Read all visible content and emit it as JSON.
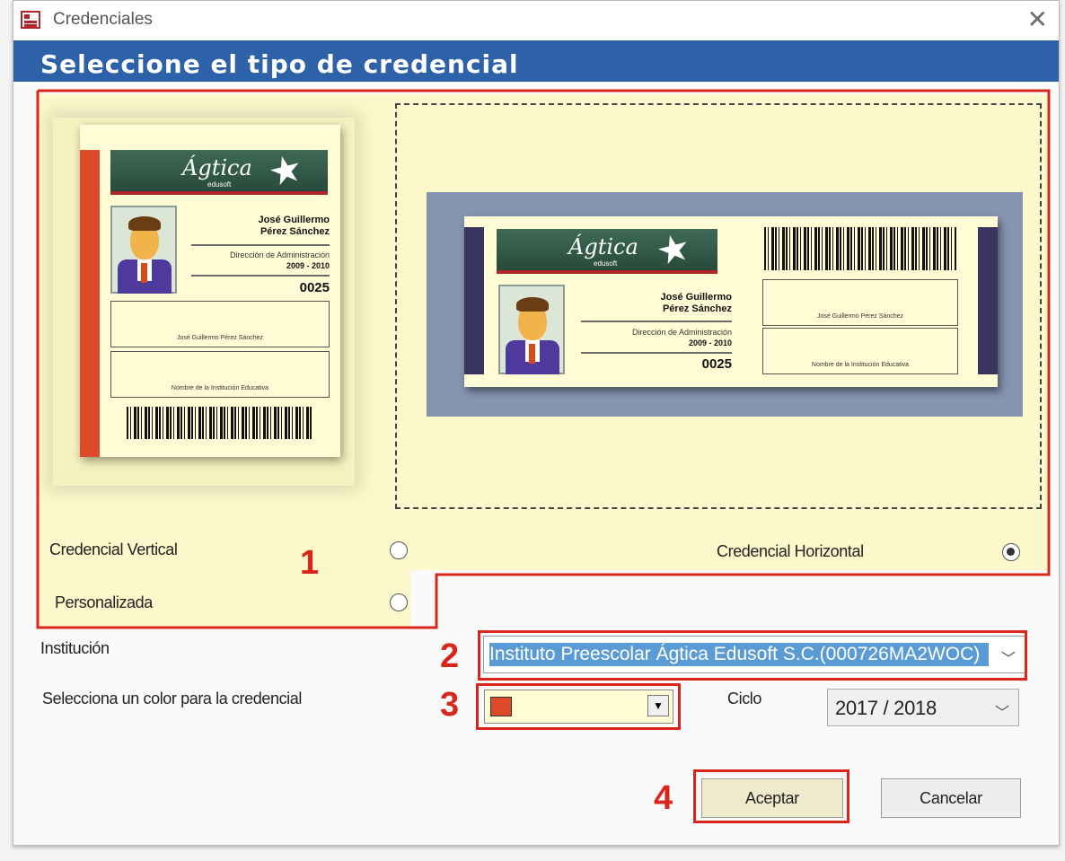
{
  "window": {
    "title": "Credenciales",
    "close_glyph": "✕"
  },
  "header": {
    "title": "Seleccione el tipo de credencial"
  },
  "card": {
    "logo": "Ágtica",
    "logo_sub": "edusoft",
    "name_line1": "José Guillermo",
    "name_line2": "Pérez Sánchez",
    "department": "Dirección de Administración",
    "period": "2009 - 2010",
    "number": "0025",
    "signature_caption": "José Guillermo Pérez Sánchez",
    "institution_caption": "Nombre de la Institución Educativa",
    "stripe_color": "#dd4a2a"
  },
  "options": {
    "vertical": {
      "label": "Credencial Vertical",
      "selected": false
    },
    "horizontal": {
      "label": "Credencial Horizontal",
      "selected": true
    },
    "custom": {
      "label": "Personalizada",
      "selected": false
    }
  },
  "form": {
    "institution_label": "Institución",
    "institution_value": "Instituto Preescolar Ágtica Edusoft S.C.(000726MA2WOC)",
    "color_label": "Selecciona un color para la credencial",
    "color_value": "#dd4a2a",
    "cycle_label": "Ciclo",
    "cycle_value": "2017 / 2018"
  },
  "buttons": {
    "accept": "Aceptar",
    "cancel": "Cancelar"
  },
  "annotations": [
    "1",
    "2",
    "3",
    "4"
  ],
  "colors": {
    "header": "#2d62a8",
    "panel": "#fcf8cb",
    "annotation": "#d9261c",
    "selection": "#5b9bd5"
  }
}
